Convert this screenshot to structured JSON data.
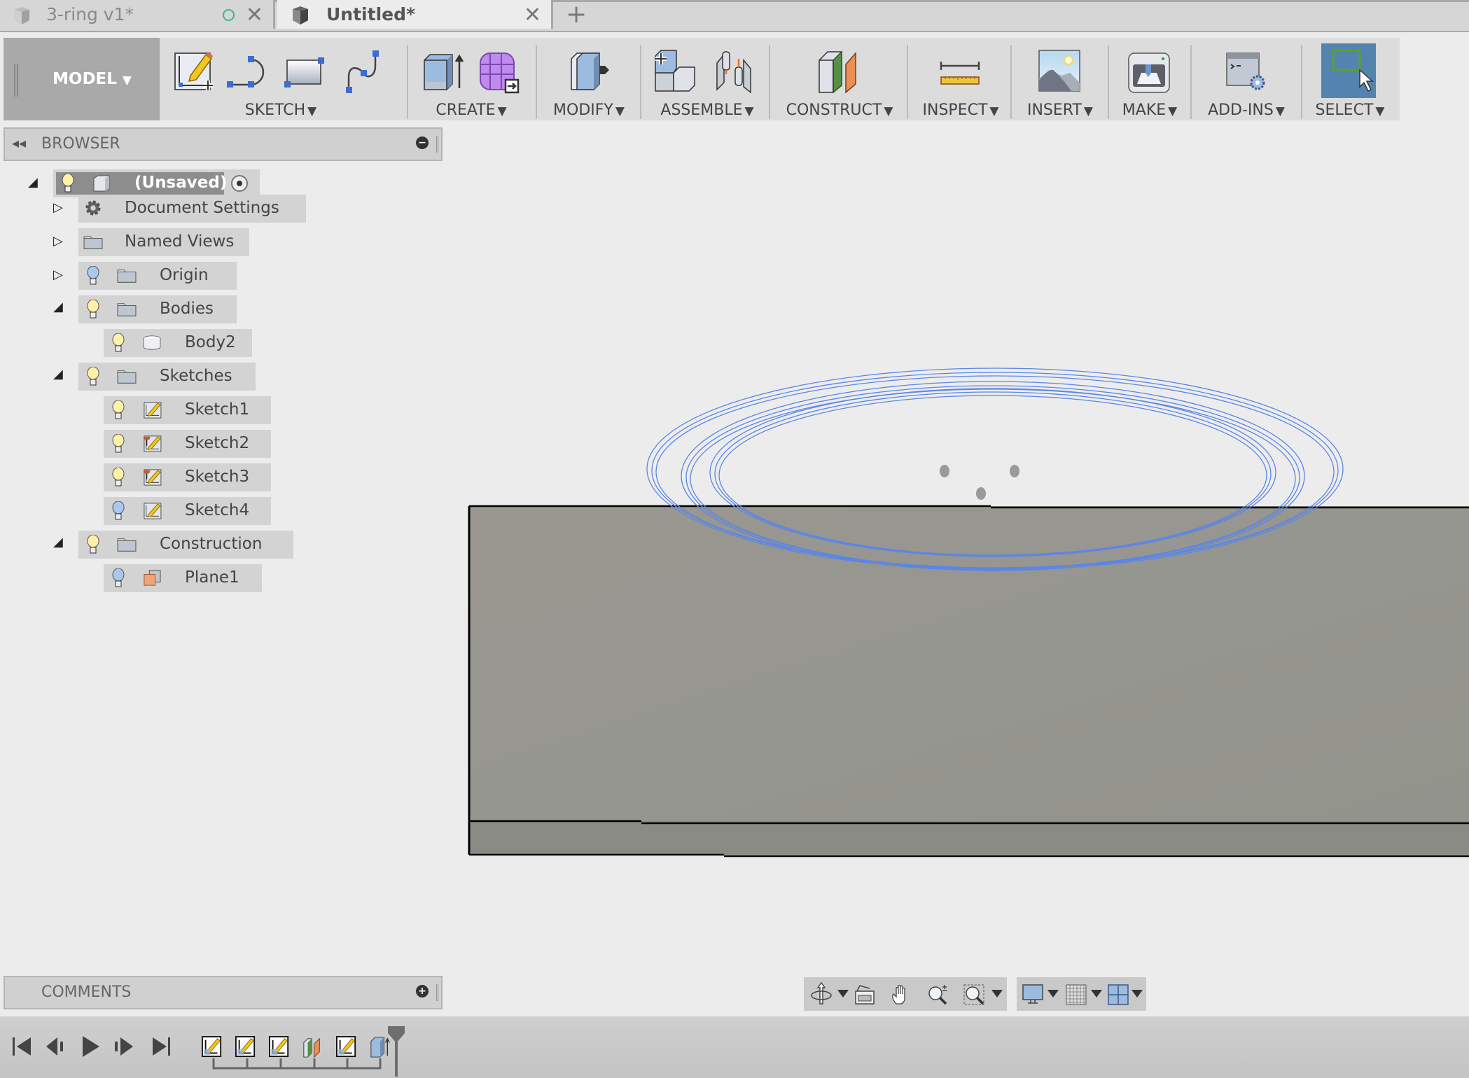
{
  "tabs": [
    {
      "label": "3-ring v1*",
      "active": false,
      "status": "unsaved-circle"
    },
    {
      "label": "Untitled*",
      "active": true
    }
  ],
  "new_tab_label": "+",
  "toolbar": {
    "workspace": "MODEL",
    "groups": [
      {
        "label": "SKETCH",
        "icons": [
          "create-sketch-icon",
          "arc-icon",
          "rectangle-icon",
          "spline-icon"
        ]
      },
      {
        "label": "CREATE",
        "icons": [
          "extrude-icon",
          "create-form-icon"
        ]
      },
      {
        "label": "MODIFY",
        "icons": [
          "press-pull-icon"
        ]
      },
      {
        "label": "ASSEMBLE",
        "icons": [
          "new-component-icon",
          "joint-icon"
        ]
      },
      {
        "label": "CONSTRUCT",
        "icons": [
          "offset-plane-icon"
        ]
      },
      {
        "label": "INSPECT",
        "icons": [
          "measure-icon"
        ]
      },
      {
        "label": "INSERT",
        "icons": [
          "insert-image-icon"
        ]
      },
      {
        "label": "MAKE",
        "icons": [
          "3d-print-icon"
        ]
      },
      {
        "label": "ADD-INS",
        "icons": [
          "scripts-addins-icon"
        ]
      },
      {
        "label": "SELECT",
        "icons": [
          "select-window-icon"
        ],
        "active": true
      }
    ]
  },
  "browser": {
    "title": "BROWSER",
    "root": {
      "label": "(Unsaved)",
      "expanded": true,
      "visible": true
    },
    "items": [
      {
        "label": "Document Settings",
        "icon": "gear-icon",
        "level": 1,
        "expander": "collapsed"
      },
      {
        "label": "Named Views",
        "icon": "folder-icon",
        "level": 1,
        "expander": "collapsed"
      },
      {
        "label": "Origin",
        "icon": "folder-icon",
        "level": 1,
        "expander": "collapsed",
        "light": "hidden"
      },
      {
        "label": "Bodies",
        "icon": "folder-icon",
        "level": 1,
        "expander": "expanded",
        "light": "visible"
      },
      {
        "label": "Body2",
        "icon": "body-icon",
        "level": 2,
        "light": "visible"
      },
      {
        "label": "Sketches",
        "icon": "folder-icon",
        "level": 1,
        "expander": "expanded",
        "light": "visible"
      },
      {
        "label": "Sketch1",
        "icon": "sketch-icon",
        "level": 2,
        "light": "visible"
      },
      {
        "label": "Sketch2",
        "icon": "sketch-pinned-icon",
        "level": 2,
        "light": "visible"
      },
      {
        "label": "Sketch3",
        "icon": "sketch-pinned-icon",
        "level": 2,
        "light": "visible"
      },
      {
        "label": "Sketch4",
        "icon": "sketch-icon",
        "level": 2,
        "light": "hidden"
      },
      {
        "label": "Construction",
        "icon": "folder-icon",
        "level": 1,
        "expander": "expanded",
        "light": "visible"
      },
      {
        "label": "Plane1",
        "icon": "plane-icon",
        "level": 2,
        "light": "hidden"
      }
    ]
  },
  "comments": {
    "title": "COMMENTS"
  },
  "timeline": {
    "controls": [
      "first",
      "previous",
      "play",
      "next",
      "last"
    ],
    "features": [
      "sketch",
      "sketch",
      "sketch",
      "plane",
      "sketch",
      "extrude"
    ]
  },
  "navbar": {
    "icons": [
      "orbit-icon",
      "look-at-icon",
      "pan-icon",
      "zoom-icon",
      "fit-icon",
      "display-settings-icon",
      "grid-icon",
      "viewports-icon"
    ]
  },
  "colors": {
    "sketch_line": "#5b86e6",
    "body_face": "#96958d",
    "body_bottom_face": "#8a8b84",
    "select_active": "#5583b0"
  }
}
